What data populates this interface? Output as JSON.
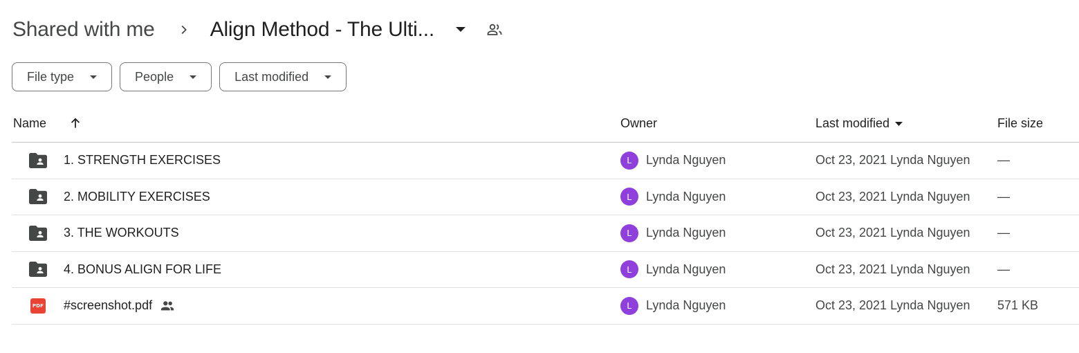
{
  "breadcrumb": {
    "root": "Shared with me",
    "current": "Align Method - The Ulti..."
  },
  "filters": [
    {
      "label": "File type"
    },
    {
      "label": "People"
    },
    {
      "label": "Last modified"
    }
  ],
  "table": {
    "headers": {
      "name": "Name",
      "owner": "Owner",
      "last_modified": "Last modified",
      "file_size": "File size"
    },
    "rows": [
      {
        "type": "shared-folder",
        "name": "1. STRENGTH EXERCISES",
        "owner_initial": "L",
        "owner": "Lynda Nguyen",
        "modified": "Oct 23, 2021 Lynda Nguyen",
        "size": "—"
      },
      {
        "type": "shared-folder",
        "name": "2. MOBILITY EXERCISES",
        "owner_initial": "L",
        "owner": "Lynda Nguyen",
        "modified": "Oct 23, 2021 Lynda Nguyen",
        "size": "—"
      },
      {
        "type": "shared-folder",
        "name": "3. THE WORKOUTS",
        "owner_initial": "L",
        "owner": "Lynda Nguyen",
        "modified": "Oct 23, 2021 Lynda Nguyen",
        "size": "—"
      },
      {
        "type": "shared-folder",
        "name": "4. BONUS ALIGN FOR LIFE",
        "owner_initial": "L",
        "owner": "Lynda Nguyen",
        "modified": "Oct 23, 2021 Lynda Nguyen",
        "size": "—"
      },
      {
        "type": "pdf",
        "name": "#screenshot.pdf",
        "icon_text": "PDF",
        "owner_initial": "L",
        "owner": "Lynda Nguyen",
        "modified": "Oct 23, 2021 Lynda Nguyen",
        "size": "571 KB"
      }
    ]
  },
  "colors": {
    "avatar": "#8f3fdb",
    "pdf": "#ea4335",
    "folder": "#444746"
  }
}
